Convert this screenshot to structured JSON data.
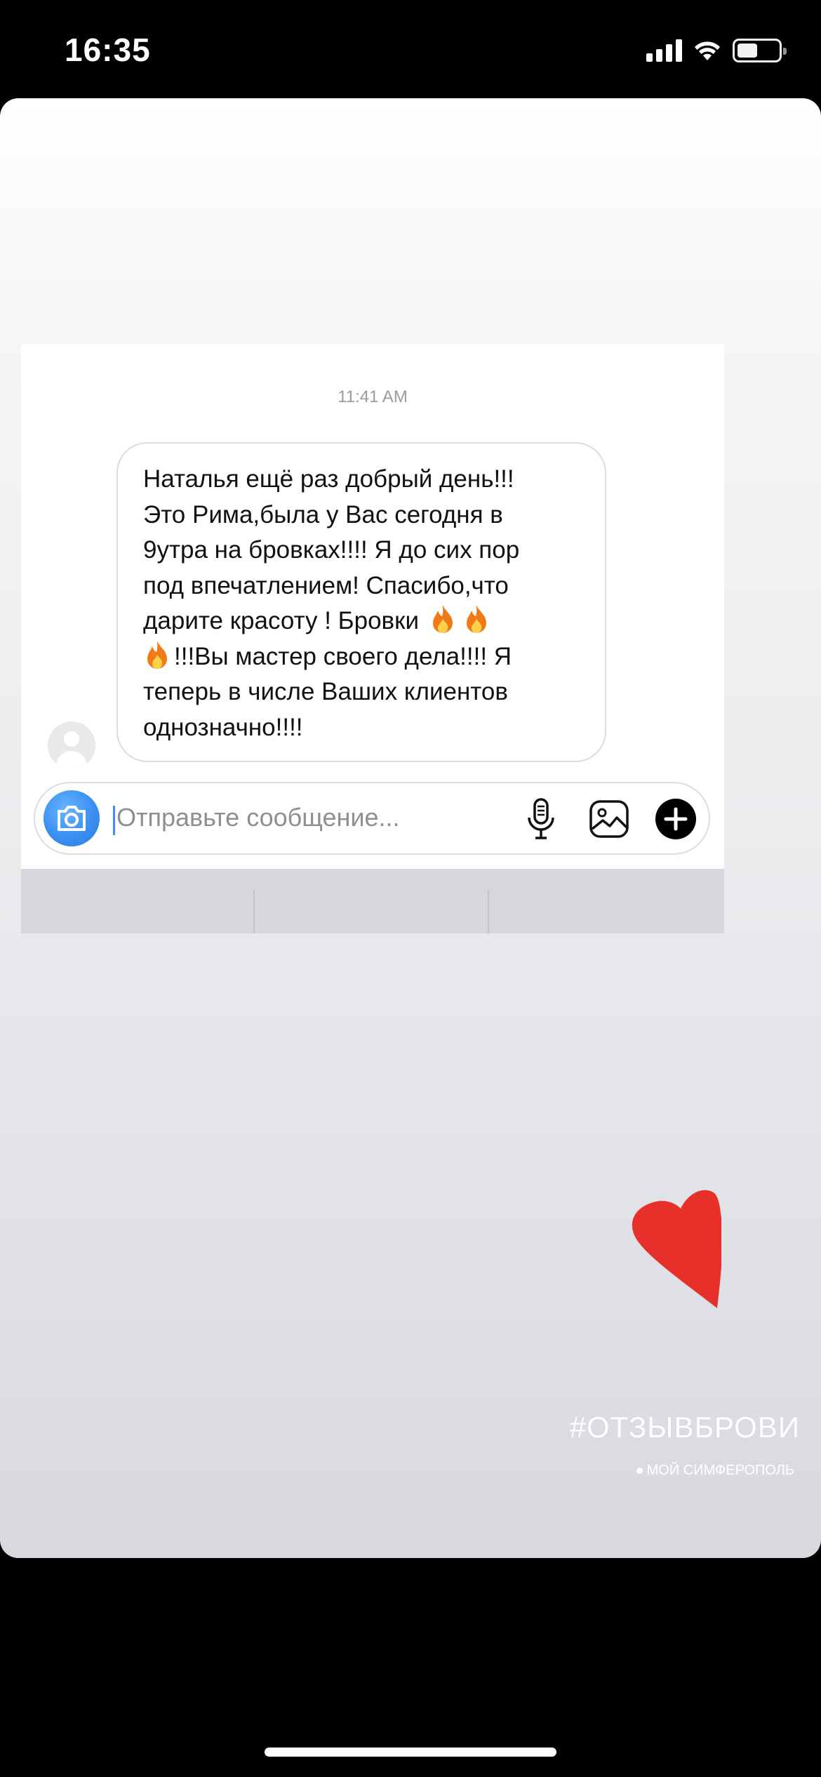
{
  "status_bar": {
    "time": "16:35",
    "icons": [
      "cellular-signal-icon",
      "wifi-icon",
      "battery-icon"
    ],
    "battery_level": 0.5
  },
  "chat": {
    "timestamp": "11:41 AM",
    "message_lines": [
      "Наталья ещё раз добрый день!!!",
      "Это Рима,была у Вас сегодня в",
      "9утра на бровках!!!! Я до сих пор",
      "под впечатлением! Спасибо,что",
      "дарите красоту ! Бровки",
      "!!!Вы мастер своего дела!!!! Я",
      "теперь в числе Ваших клиентов",
      "однозначно!!!!"
    ],
    "composer_placeholder": "Отправьте сообщение...",
    "composer_icons": [
      "camera-icon",
      "microphone-icon",
      "gallery-icon",
      "plus-icon"
    ]
  },
  "story": {
    "hashtag": "#ОТЗЫВБРОВИ",
    "location": "МОЙ СИМФЕРОПОЛЬ",
    "sticker": "heart-icon"
  },
  "colors": {
    "accent_blue": "#3b8ff0",
    "heart_red": "#e8302a",
    "fire_orange": "#f07a1a"
  }
}
